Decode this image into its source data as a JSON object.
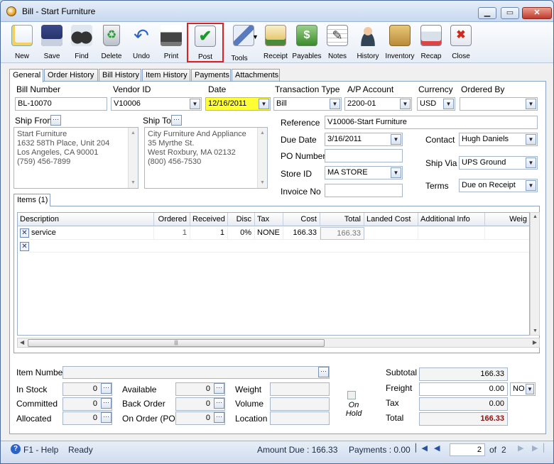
{
  "window": {
    "title": "Bill - Start Furniture"
  },
  "toolbar": [
    {
      "label": "New",
      "icon": "new-document-icon"
    },
    {
      "label": "Save",
      "icon": "floppy-disk-icon"
    },
    {
      "label": "Find",
      "icon": "binoculars-icon"
    },
    {
      "label": "Delete",
      "icon": "recycle-bin-icon"
    },
    {
      "label": "Undo",
      "icon": "undo-arrow-icon"
    },
    {
      "label": "Print",
      "icon": "printer-icon"
    },
    {
      "label": "Post",
      "icon": "post-checkmark-icon",
      "highlighted": true
    },
    {
      "label": "Tools",
      "icon": "tools-icon"
    },
    {
      "label": "Receipt",
      "icon": "receipt-icon"
    },
    {
      "label": "Payables",
      "icon": "payables-icon"
    },
    {
      "label": "Notes",
      "icon": "notes-pen-icon"
    },
    {
      "label": "History",
      "icon": "history-person-icon"
    },
    {
      "label": "Inventory",
      "icon": "inventory-boxes-icon"
    },
    {
      "label": "Recap",
      "icon": "recap-icon"
    },
    {
      "label": "Close",
      "icon": "close-window-icon"
    }
  ],
  "tabs": [
    "General",
    "Order History",
    "Bill History",
    "Item History",
    "Payments",
    "Attachments"
  ],
  "form": {
    "bill_number_label": "Bill Number",
    "bill_number": "BL-10070",
    "vendor_id_label": "Vendor ID",
    "vendor_id": "V10006",
    "date_label": "Date",
    "date": "12/16/2011",
    "transaction_type_label": "Transaction Type",
    "transaction_type": "Bill",
    "ap_account_label": "A/P Account",
    "ap_account": "2200-01",
    "currency_label": "Currency",
    "currency": "USD",
    "ordered_by_label": "Ordered By",
    "ordered_by": "",
    "ship_from_label": "Ship From",
    "ship_from": "Start Furniture\n1632 58Th Place, Unit 204\nLos Angeles, CA 90001\n(759) 456-7899",
    "ship_to_label": "Ship To",
    "ship_to": "City Furniture And Appliance\n35 Myrthe St.\nWest Roxbury, MA 02132\n(800) 456-7530",
    "reference_label": "Reference",
    "reference": "V10006-Start Furniture",
    "due_date_label": "Due Date",
    "due_date": "3/16/2011",
    "po_number_label": "PO Number",
    "po_number": "",
    "store_id_label": "Store ID",
    "store_id": "MA STORE",
    "invoice_no_label": "Invoice No",
    "invoice_no": "",
    "contact_label": "Contact",
    "contact": "Hugh Daniels",
    "ship_via_label": "Ship Via",
    "ship_via": "UPS Ground",
    "terms_label": "Terms",
    "terms": "Due on Receipt"
  },
  "items_tab": "Items (1)",
  "grid": {
    "columns": [
      "Description",
      "Ordered",
      "Received",
      "Disc",
      "Tax",
      "Cost",
      "Total",
      "Landed Cost",
      "Additional Info",
      "Weig"
    ],
    "rows": [
      {
        "description": "service",
        "ordered": "1",
        "received": "1",
        "disc": "0%",
        "tax": "NONE",
        "cost": "166.33",
        "total": "166.33",
        "landed_cost": "",
        "additional_info": "",
        "weight": ""
      }
    ]
  },
  "bottom": {
    "item_number_label": "Item Number",
    "item_number": "",
    "in_stock_label": "In Stock",
    "in_stock": "0",
    "committed_label": "Committed",
    "committed": "0",
    "allocated_label": "Allocated",
    "allocated": "0",
    "available_label": "Available",
    "available": "0",
    "back_order_label": "Back Order",
    "back_order": "0",
    "on_order_label": "On Order (PO)",
    "on_order": "0",
    "weight_label": "Weight",
    "weight": "",
    "volume_label": "Volume",
    "volume": "",
    "location_label": "Location",
    "location": "",
    "on_hold_label": "On Hold",
    "subtotal_label": "Subtotal",
    "subtotal": "166.33",
    "freight_label": "Freight",
    "freight": "0.00",
    "freight_flag": "NO",
    "tax_label": "Tax",
    "tax": "0.00",
    "total_label": "Total",
    "total": "166.33"
  },
  "status": {
    "help": "F1 - Help",
    "state": "Ready",
    "amount_due": "Amount Due : 166.33",
    "payments": "Payments : 0.00",
    "page": "2",
    "of": "of",
    "total_pages": "2"
  },
  "colors": {
    "accent": "#2a50a0",
    "highlight": "#ffff33",
    "post_border": "#dd2222",
    "total_text": "#8a1010"
  }
}
